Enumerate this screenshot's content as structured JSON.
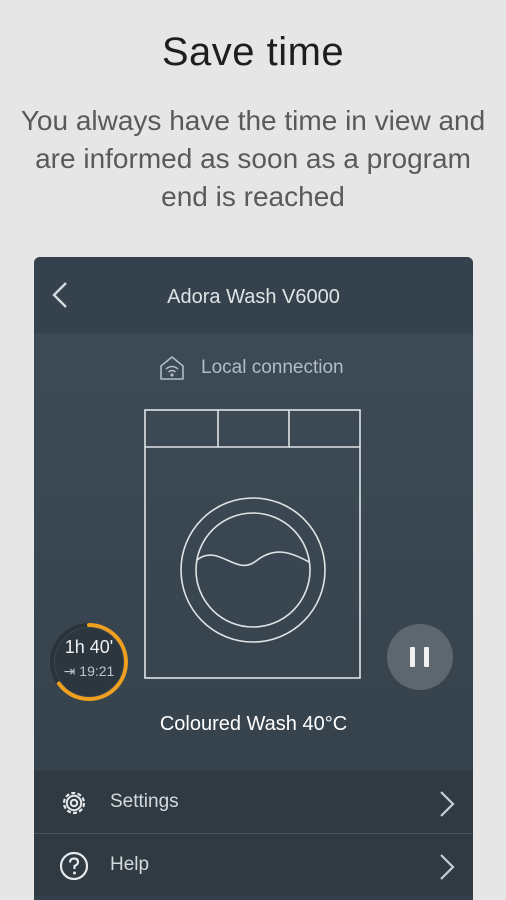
{
  "promo": {
    "title": "Save time",
    "subtitle": "You always have the time in view and are informed as soon as a program end is reached"
  },
  "app": {
    "title": "Adora Wash V6000",
    "connection_label": "Local connection",
    "timer": {
      "duration": "1h 40'",
      "end_time": "19:21",
      "progress_fraction": 0.65
    },
    "program_label": "Coloured Wash 40°C",
    "menu": [
      {
        "label": "Settings",
        "icon": "gear-icon"
      },
      {
        "label": "Help",
        "icon": "help-icon"
      }
    ],
    "colors": {
      "accent": "#f0a020",
      "background": "#3b4853"
    }
  }
}
